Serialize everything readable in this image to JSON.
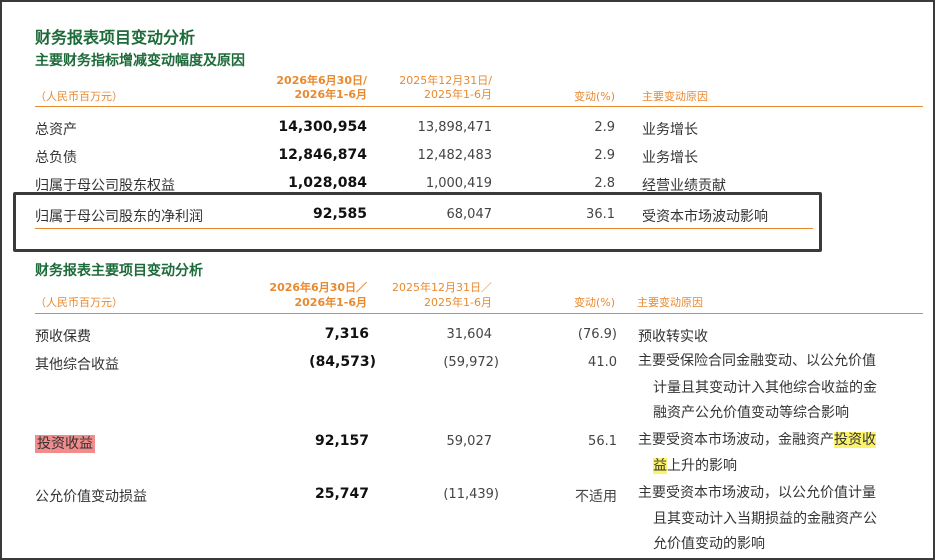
{
  "title": "财务报表项目变动分析",
  "section1": {
    "heading": "主要财务指标增减变动幅度及原因",
    "header": {
      "unit": "（人民币百万元）",
      "cur_line1": "2026年6月30日/",
      "cur_line2": "2026年1-6月",
      "prev_line1": "2025年12月31日/",
      "prev_line2": "2025年1-6月",
      "change": "变动(%)",
      "reason": "主要变动原因"
    },
    "rows": [
      {
        "label": "总资产",
        "cur": "14,300,954",
        "prev": "13,898,471",
        "change": "2.9",
        "reason": "业务增长"
      },
      {
        "label": "总负债",
        "cur": "12,846,874",
        "prev": "12,482,483",
        "change": "2.9",
        "reason": "业务增长"
      },
      {
        "label": "归属于母公司股东权益",
        "cur": "1,028,084",
        "prev": "1,000,419",
        "change": "2.8",
        "reason": "经营业绩贡献"
      },
      {
        "label": "归属于母公司股东的净利润",
        "cur": "92,585",
        "prev": "68,047",
        "change": "36.1",
        "reason": "受资本市场波动影响"
      }
    ]
  },
  "section2": {
    "heading": "财务报表主要项目变动分析",
    "header": {
      "unit": "（人民币百万元）",
      "cur_line1": "2026年6月30日／",
      "cur_line2": "2026年1-6月",
      "prev_line1": "2025年12月31日／",
      "prev_line2": "2025年1-6月",
      "change": "变动(%)",
      "reason": "主要变动原因"
    },
    "rows": [
      {
        "label": "预收保费",
        "cur": "7,316",
        "prev": "31,604",
        "change": "(76.9)",
        "reason_lines": [
          "预收转实收"
        ]
      },
      {
        "label": "其他综合收益",
        "cur": "(84,573)",
        "prev": "(59,972)",
        "change": "41.0",
        "reason_lines": [
          "主要受保险合同金融变动、以公允价值",
          "计量且其变动计入其他综合收益的金",
          "融资产公允价值变动等综合影响"
        ]
      },
      {
        "label": "投资收益",
        "cur": "92,157",
        "prev": "59,027",
        "change": "56.1",
        "reason_parts": {
          "a": "主要受资本市场波动，金融资产",
          "b": "投资收",
          "c": "益",
          "d": "上升的影响"
        }
      },
      {
        "label": "公允价值变动损益",
        "cur": "25,747",
        "prev": "(11,439)",
        "change": "不适用",
        "reason_lines": [
          "主要受资本市场波动，以公允价值计量",
          "且其变动计入当期损益的金融资产公",
          "允价值变动的影响"
        ]
      }
    ]
  },
  "colors": {
    "green": "#1e6b3a",
    "orange": "#e8892e",
    "highlight_red": "#f28b8b",
    "highlight_yellow": "#fbf36a"
  }
}
